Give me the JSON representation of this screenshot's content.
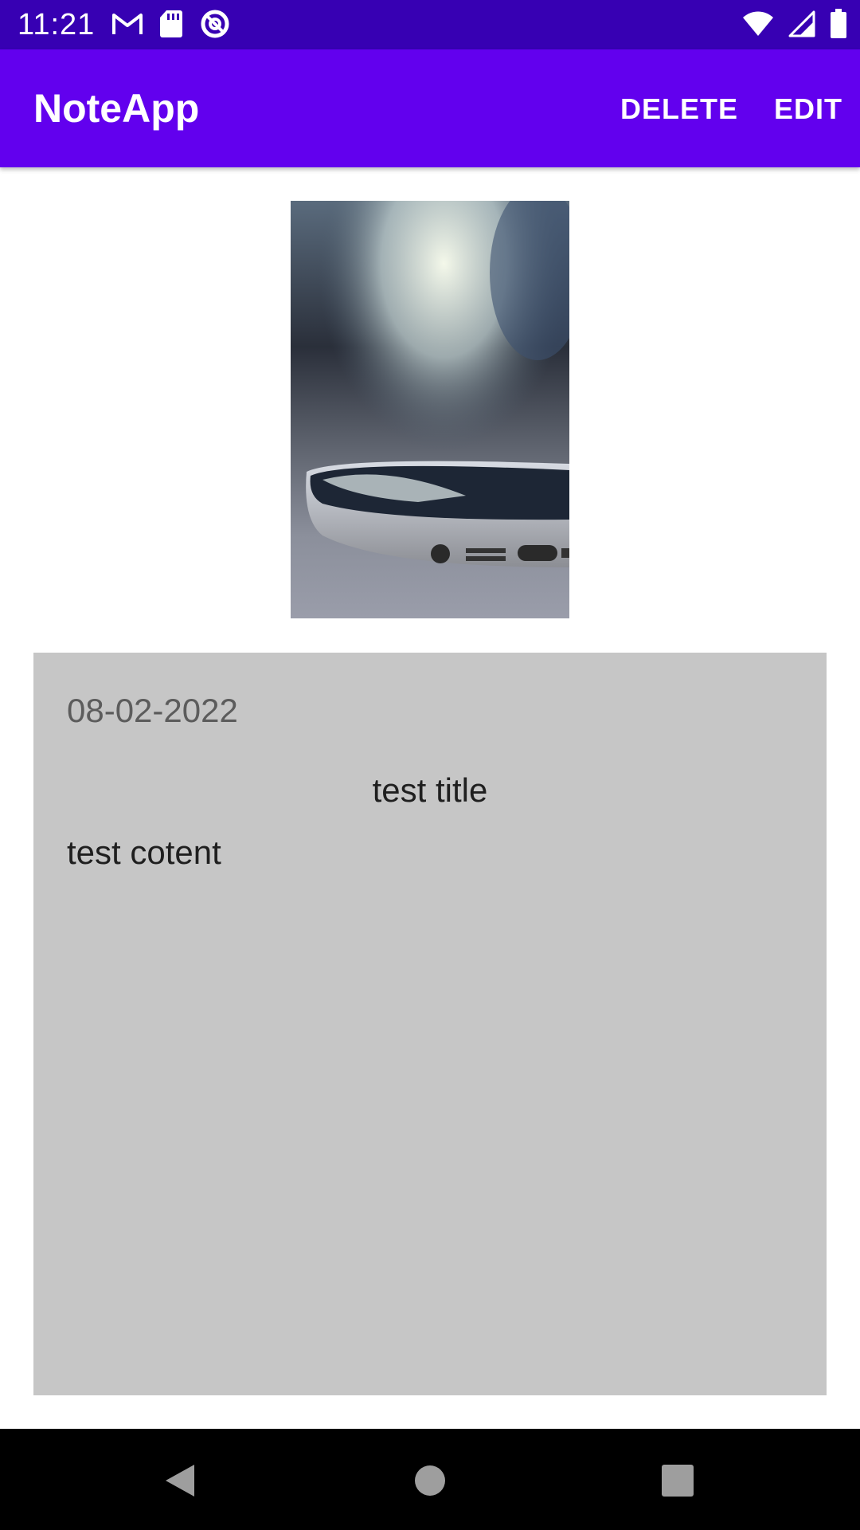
{
  "status_bar": {
    "time": "11:21",
    "left_icons": [
      "gmail-icon",
      "sd-card-icon",
      "data-saver-icon"
    ],
    "right_icons": [
      "wifi-icon",
      "signal-icon",
      "battery-icon"
    ],
    "background": "#3700b3"
  },
  "app_bar": {
    "title": "NoteApp",
    "actions": {
      "delete_label": "DELETE",
      "edit_label": "EDIT"
    },
    "background": "#6200ee"
  },
  "note": {
    "image_icon": "phone-photo",
    "date": "08-02-2022",
    "title": "test title",
    "content": "test cotent",
    "card_background": "#c6c6c6"
  },
  "nav_bar": {
    "buttons": [
      "back-icon",
      "home-icon",
      "recents-icon"
    ]
  }
}
